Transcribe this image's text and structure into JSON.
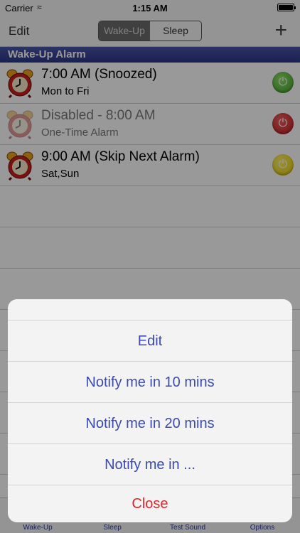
{
  "status_bar": {
    "carrier": "Carrier",
    "time": "1:15 AM"
  },
  "nav": {
    "edit_label": "Edit",
    "segments": [
      "Wake-Up",
      "Sleep"
    ],
    "selected_segment": "Wake-Up",
    "add_label": "+"
  },
  "section_title": "Wake-Up Alarm",
  "alarms": [
    {
      "title": "7:00 AM (Snoozed)",
      "subtitle": "Mon to Fri",
      "enabled": true,
      "status_color": "#4caf2a"
    },
    {
      "title": "Disabled - 8:00 AM",
      "subtitle": "One-Time Alarm",
      "enabled": false,
      "status_color": "#d3191e"
    },
    {
      "title": "9:00 AM (Skip Next Alarm)",
      "subtitle": "Sat,Sun",
      "enabled": true,
      "status_color": "#e8cc00"
    }
  ],
  "tab_bar": {
    "tabs": [
      "Wake-Up",
      "Sleep",
      "Test Sound",
      "Options"
    ]
  },
  "action_sheet": {
    "buttons": [
      "Edit",
      "Notify me in 10 mins",
      "Notify me in 20 mins",
      "Notify me in ..."
    ],
    "close_label": "Close"
  },
  "colors": {
    "accent": "#3a4ab2",
    "destructive": "#e0252b",
    "section_header": "#2c3788"
  }
}
